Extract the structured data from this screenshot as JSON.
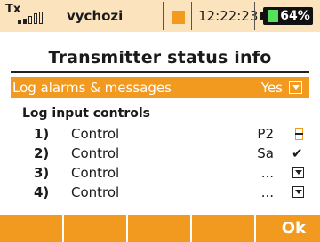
{
  "status_bar": {
    "tx_label": "Tx",
    "signal_bars": 5,
    "signal_level": 0.4,
    "model_name": "vychozi",
    "time": "12:22:23",
    "battery_percent": "64%",
    "battery_level": 0.64,
    "accent_color": "#f39a1e"
  },
  "title": "Transmitter status info",
  "selected_row": {
    "label": "Log alarms & messages",
    "value": "Yes"
  },
  "section_title": "Log input controls",
  "controls": [
    {
      "num": "1)",
      "label": "Control",
      "value": "P2",
      "icon": "switch-icon"
    },
    {
      "num": "2)",
      "label": "Control",
      "value": "Sa",
      "icon": "checkmark-icon"
    },
    {
      "num": "3)",
      "label": "Control",
      "value": "...",
      "icon": "dropdown-icon"
    },
    {
      "num": "4)",
      "label": "Control",
      "value": "...",
      "icon": "dropdown-icon"
    }
  ],
  "bottom_bar": {
    "ok_label": "Ok"
  },
  "colors": {
    "orange": "#f29a20",
    "status_bg": "#fbe3be"
  }
}
